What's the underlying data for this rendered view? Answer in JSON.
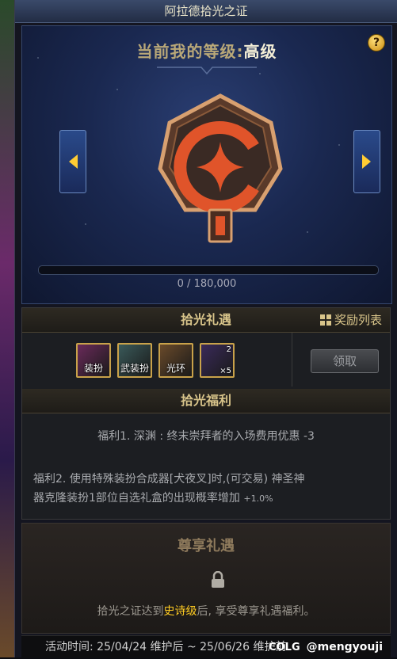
{
  "window": {
    "title": "阿拉德拾光之证"
  },
  "header": {
    "level_label": "当前我的等级:",
    "level_value": "高级",
    "help_icon_glyph": "?"
  },
  "progress": {
    "text": "0 / 180,000",
    "current": 0,
    "max": 180000
  },
  "gift": {
    "title": "拾光礼遇",
    "reward_list_label": "奖励列表",
    "items": [
      {
        "name": "装扮",
        "icon": "outfit-icon",
        "color": "#6a2a5a"
      },
      {
        "name": "武装扮",
        "icon": "weapon-outfit-icon",
        "color": "#3a5a5a"
      },
      {
        "name": "光环",
        "icon": "aura-icon",
        "color": "#6a4a2a"
      },
      {
        "name": "",
        "icon": "gold-box-icon",
        "color": "#3a2a5a",
        "count_top": "2",
        "count_bottom": "×5"
      }
    ],
    "claim_label": "领取"
  },
  "welfare": {
    "title": "拾光福利",
    "line1": "福利1. 深渊 : 终末崇拜者的入场费用优惠 -3",
    "line2a": "福利2. 使用特殊装扮合成器[犬夜叉]时,(可交易) 神圣神",
    "line2b": "器克隆装扮1部位自选礼盒的出现概率增加",
    "line2_suffix": "+1.0%"
  },
  "vip": {
    "title": "尊享礼遇",
    "desc_prefix": "拾光之证达到",
    "desc_highlight": "史诗级",
    "desc_suffix": "后, 享受尊享礼遇福利。"
  },
  "footer": {
    "timeline": "活动时间: 25/04/24 维护后 ~ 25/06/26 维护前",
    "brand_logo": "COLG",
    "brand_user": "@mengyouji"
  },
  "colors": {
    "accent_gold": "#d8c48a",
    "highlight_yellow": "#ffcc22",
    "emblem_orange": "#e0542a"
  }
}
